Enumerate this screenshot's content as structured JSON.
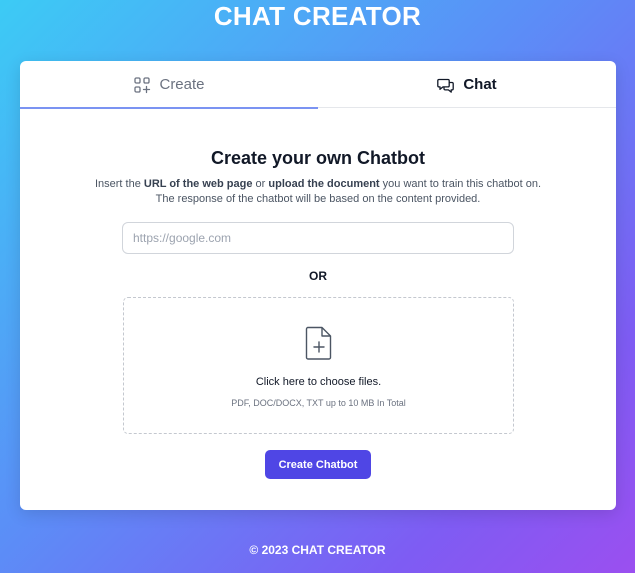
{
  "app": {
    "title": "CHAT CREATOR"
  },
  "tabs": [
    {
      "label": "Create",
      "icon": "grid-plus-icon",
      "active": true
    },
    {
      "label": "Chat",
      "icon": "chat-bubbles-icon",
      "active": false
    }
  ],
  "create": {
    "heading": "Create your own Chatbot",
    "desc_prefix": "Insert the ",
    "desc_url": "URL of the web page",
    "desc_or": " or ",
    "desc_upload": "upload the document",
    "desc_suffix": " you want to train this chatbot on. The response of the chatbot will be based on the content provided.",
    "url_placeholder": "https://google.com",
    "url_value": "",
    "or_label": "OR",
    "dropzone_main": "Click here to choose files.",
    "dropzone_sub": "PDF, DOC/DOCX, TXT up to 10 MB In Total",
    "dropzone_icon": "file-plus-icon",
    "submit_label": "Create Chatbot"
  },
  "footer": {
    "text": "© 2023 CHAT CREATOR"
  },
  "colors": {
    "accent": "#4f46e5",
    "tab_underline": "#7b93f2",
    "gradient_start": "#3ccbf5",
    "gradient_end": "#9b4ff0"
  }
}
